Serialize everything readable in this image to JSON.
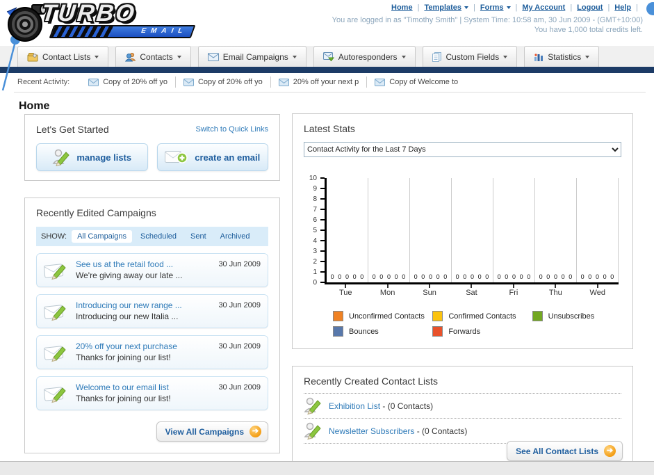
{
  "header": {
    "logo": {
      "title": "TURBO",
      "subtitle": "EMAIL"
    },
    "nav_links": [
      {
        "label": "Home",
        "dropdown": false
      },
      {
        "label": "Templates",
        "dropdown": true
      },
      {
        "label": "Forms",
        "dropdown": true
      },
      {
        "label": "My Account",
        "dropdown": false
      },
      {
        "label": "Logout",
        "dropdown": false
      },
      {
        "label": "Help",
        "dropdown": false
      }
    ],
    "login_status": "You are logged in as \"Timothy Smith\" | System Time: 10:58 am, 30 Jun 2009 - (GMT+10:00)",
    "credits": "You have 1,000 total credits left."
  },
  "nav_tabs": [
    {
      "label": "Contact Lists"
    },
    {
      "label": "Contacts"
    },
    {
      "label": "Email Campaigns"
    },
    {
      "label": "Autoresponders"
    },
    {
      "label": "Custom Fields"
    },
    {
      "label": "Statistics"
    }
  ],
  "recent_activity": {
    "label": "Recent Activity:",
    "items": [
      "Copy of 20% off yo",
      "Copy of 20% off yo",
      "20% off your next p",
      "Copy of Welcome to"
    ]
  },
  "page_title": "Home",
  "get_started": {
    "title": "Let's Get Started",
    "switch_link": "Switch to Quick Links",
    "manage_lists_label": "manage lists",
    "create_email_label": "create an email"
  },
  "campaigns": {
    "title": "Recently Edited Campaigns",
    "show_label": "SHOW:",
    "filters": [
      {
        "label": "All Campaigns",
        "active": true
      },
      {
        "label": "Scheduled",
        "active": false
      },
      {
        "label": "Sent",
        "active": false
      },
      {
        "label": "Archived",
        "active": false
      }
    ],
    "items": [
      {
        "title": "See us at the retail food ...",
        "subtitle": "We're giving away our late ...",
        "date": "30 Jun 2009"
      },
      {
        "title": "Introducing our new range ...",
        "subtitle": "Introducing our new Italia ...",
        "date": "30 Jun 2009"
      },
      {
        "title": "20% off your next purchase",
        "subtitle": "Thanks for joining our list!",
        "date": "30 Jun 2009"
      },
      {
        "title": "Welcome to our email list",
        "subtitle": "Thanks for joining our list!",
        "date": "30 Jun 2009"
      }
    ],
    "view_all_label": "View All Campaigns"
  },
  "latest_stats": {
    "title": "Latest Stats",
    "dropdown_value": "Contact Activity for the Last 7 Days"
  },
  "chart_data": {
    "type": "bar",
    "title": "Contact Activity for the Last 7 Days",
    "categories": [
      "Tue",
      "Mon",
      "Sun",
      "Sat",
      "Fri",
      "Thu",
      "Wed"
    ],
    "series": [
      {
        "name": "Unconfirmed Contacts",
        "color": "#f08223",
        "values": [
          0,
          0,
          0,
          0,
          0,
          0,
          0
        ]
      },
      {
        "name": "Confirmed Contacts",
        "color": "#fbc30f",
        "values": [
          0,
          0,
          0,
          0,
          0,
          0,
          0
        ]
      },
      {
        "name": "Unsubscribes",
        "color": "#73a822",
        "values": [
          0,
          0,
          0,
          0,
          0,
          0,
          0
        ]
      },
      {
        "name": "Bounces",
        "color": "#5878ab",
        "values": [
          0,
          0,
          0,
          0,
          0,
          0,
          0
        ]
      },
      {
        "name": "Forwards",
        "color": "#e8512b",
        "values": [
          0,
          0,
          0,
          0,
          0,
          0,
          0
        ]
      }
    ],
    "xlabel": "",
    "ylabel": "",
    "ylim": [
      0,
      10
    ],
    "grid": true,
    "legend_position": "bottom"
  },
  "contact_lists": {
    "title": "Recently Created Contact Lists",
    "items": [
      {
        "name": "Exhibition List",
        "suffix": " - (0 Contacts)"
      },
      {
        "name": "Newsletter Subscribers",
        "suffix": " - (0 Contacts)"
      }
    ],
    "see_all_label": "See All Contact Lists"
  }
}
